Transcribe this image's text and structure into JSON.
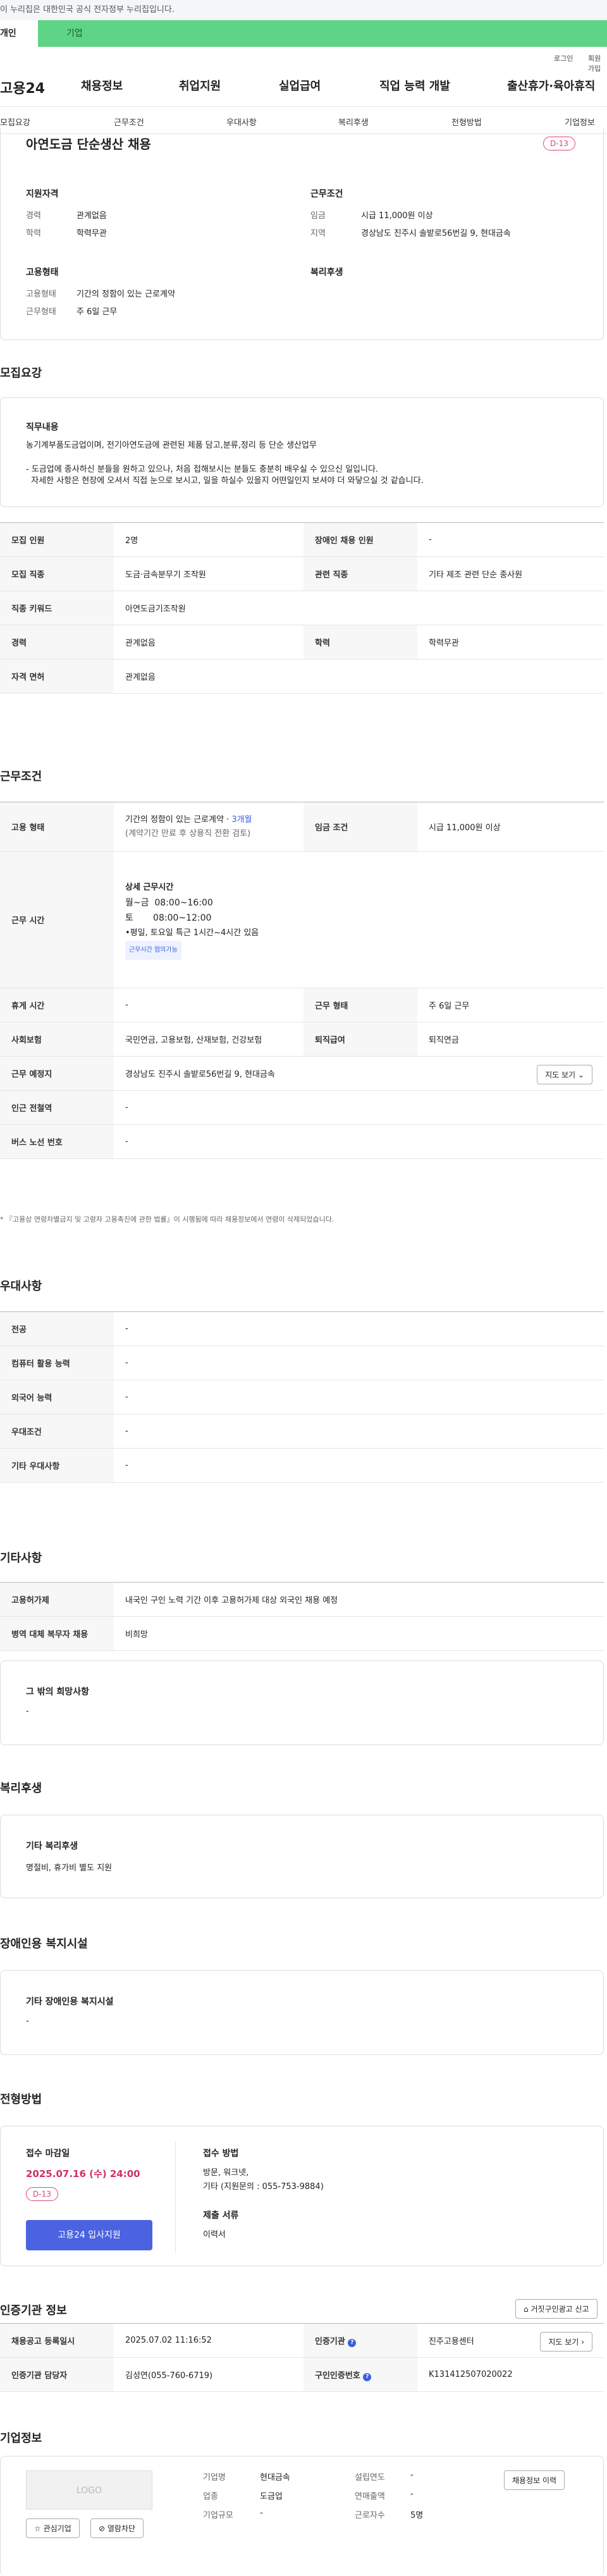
{
  "gov_banner": "이 누리집은 대한민국 공식 전자정부 누리집입니다.",
  "top_tabs": [
    "개인",
    "기업"
  ],
  "util": [
    "로그인",
    "회원가입"
  ],
  "gnb": {
    "logo": "고용24",
    "items": [
      "채용정보",
      "취업지원",
      "실업급여",
      "직업 능력 개발",
      "출산휴가·육아휴직"
    ]
  },
  "lnb": [
    "모집요강",
    "근무조건",
    "우대사항",
    "복리후생",
    "전형방법",
    "기업정보"
  ],
  "summary": {
    "title": "아연도금 단순생산 채용",
    "dday": "D-13",
    "qual_title": "지원자격",
    "qual": [
      {
        "k": "경력",
        "v": "관계없음"
      },
      {
        "k": "학력",
        "v": "학력무관"
      }
    ],
    "work_title": "근무조건",
    "work": [
      {
        "k": "임금",
        "v": "시급 11,000원 이상"
      },
      {
        "k": "지역",
        "v": "경상남도 진주시 솔밭로56번길 9, 현대금속"
      }
    ],
    "emp_title": "고용형태",
    "emp": [
      {
        "k": "고용형태",
        "v": "기간의 정함이 있는 근로계약"
      },
      {
        "k": "근무형태",
        "v": "주 6일 근무"
      }
    ],
    "welfare_title": "복리후생"
  },
  "recruit": {
    "title": "모집요강",
    "duty_title": "직무내용",
    "duty_lines": [
      "농기계부품도금업이며, 전기아연도금에 관련된 제품 담고,분류,정리 등 단순 생산업무",
      "- 도금업에 종사하신 분들을 원하고 있으나, 처음 접해보시는 분들도 충분히 배우실 수 있으신 일입니다.",
      "  자세한 사항은 현장에 오셔서 직접 눈으로 보시고, 일을 하실수 있을지 어떤일인지 보셔야 더 와닿으실 것 같습니다."
    ],
    "rows": [
      [
        {
          "k": "모집 인원",
          "v": "2명"
        },
        {
          "k": "장애인 채용 인원",
          "v": "-"
        }
      ],
      [
        {
          "k": "모집 직종",
          "v": "도금·금속분무기 조작원"
        },
        {
          "k": "관련 직종",
          "v": "기타 제조 관련 단순 종사원"
        }
      ],
      [
        {
          "k": "직종 키워드",
          "v": "아연도금기조작원"
        }
      ],
      [
        {
          "k": "경력",
          "v": "관계없음"
        },
        {
          "k": "학력",
          "v": "학력무관"
        }
      ],
      [
        {
          "k": "자격 면허",
          "v": "관계없음"
        }
      ]
    ]
  },
  "work": {
    "title": "근무조건",
    "emp_k": "고용 형태",
    "emp_v1": "기간의 정함이 있는 근로계약 · ",
    "emp_v1b": "3개월",
    "emp_v2": "(계약기간 만료 후 상용직 전환 검토)",
    "wage_k": "임금 조건",
    "wage_v": "시급 11,000원 이상",
    "time_k": "근무 시간",
    "time_lines": [
      "상세 근무시간",
      "월~금  08:00~16:00",
      "토       08:00~12:00",
      "•평일, 토요일 특근 1시간~4시간 있음"
    ],
    "time_tag": "근무시간 협의가능",
    "rows": [
      [
        {
          "k": "휴게 시간",
          "v": "-"
        },
        {
          "k": "근무 형태",
          "v": "주 6일 근무"
        }
      ],
      [
        {
          "k": "사회보험",
          "v": "국민연금, 고용보험, 산재보험, 건강보험"
        },
        {
          "k": "퇴직급여",
          "v": "퇴직연금"
        }
      ]
    ],
    "place_k": "근무 예정지",
    "place_v": "경상남도 진주시 솔밭로56번길 9, 현대금속",
    "map_btn": "지도 보기",
    "station_k": "인근 전철역",
    "station_v": "-",
    "bus_k": "버스 노선 번호",
    "bus_v": "-",
    "note": "* 『고용상 연령차별금지 및 고령자 고용촉진에 관한 법률』이 시행됨에 따라 채용정보에서 연령이 삭제되었습니다."
  },
  "pref": {
    "title": "우대사항",
    "rows": [
      {
        "k": "전공",
        "v": "-"
      },
      {
        "k": "컴퓨터 활용 능력",
        "v": "-"
      },
      {
        "k": "외국어 능력",
        "v": "-"
      },
      {
        "k": "우대조건",
        "v": "-"
      },
      {
        "k": "기타 우대사항",
        "v": "-"
      }
    ]
  },
  "etc": {
    "title": "기타사항",
    "rows": [
      {
        "k": "고용허가제",
        "v": "내국인 구인 노력 기간 이후 고용허가제 대상 외국인 채용 예정"
      },
      {
        "k": "병역 대체 복무자 채용",
        "v": "비희망"
      }
    ],
    "wish_title": "그 밖의 희망사항",
    "wish_v": "-"
  },
  "welfare": {
    "title": "복리후생",
    "box_title": "기타 복리후생",
    "box_v": "명절비, 휴가비 별도 지원"
  },
  "disabled": {
    "title": "장애인용 복지시설",
    "box_title": "기타 장애인용 복지시설",
    "box_v": "-"
  },
  "process": {
    "title": "전형방법",
    "deadline_k": "접수 마감일",
    "deadline_v": "2025.07.16 (수) 24:00",
    "dday": "D-13",
    "apply_btn": "고용24 입사지원",
    "method_k": "접수 방법",
    "method_v1": "방문, 워크넷,",
    "method_v2": "기타 (지원문의 : 055-753-9884)",
    "docs_k": "제출 서류",
    "docs_v": "이력서"
  },
  "agency": {
    "title": "인증기관 정보",
    "report_btn": "거짓구인광고 신고",
    "rows": [
      [
        {
          "k": "채용공고 등록일시",
          "v": "2025.07.02 11:16:52"
        },
        {
          "k": "인증기관",
          "v": "진주고용센터"
        }
      ],
      [
        {
          "k": "인증기관 담당자",
          "v": "김성연(055-760-6719)"
        },
        {
          "k": "구인인증번호",
          "v": "K131412507020022"
        }
      ]
    ],
    "map_btn": "지도 보기"
  },
  "company": {
    "title": "기업정보",
    "logo": "LOGO",
    "fav_btn": "관심기업",
    "block_btn": "열람차단",
    "history_btn": "채용정보 이력",
    "fields": [
      {
        "k": "기업명",
        "v": "현대금속"
      },
      {
        "k": "설립연도",
        "v": "-"
      },
      {
        "k": "업종",
        "v": "도금업"
      },
      {
        "k": "연매출액",
        "v": "-"
      },
      {
        "k": "기업규모",
        "v": "-"
      },
      {
        "k": "근로자수",
        "v": "5명"
      }
    ]
  }
}
